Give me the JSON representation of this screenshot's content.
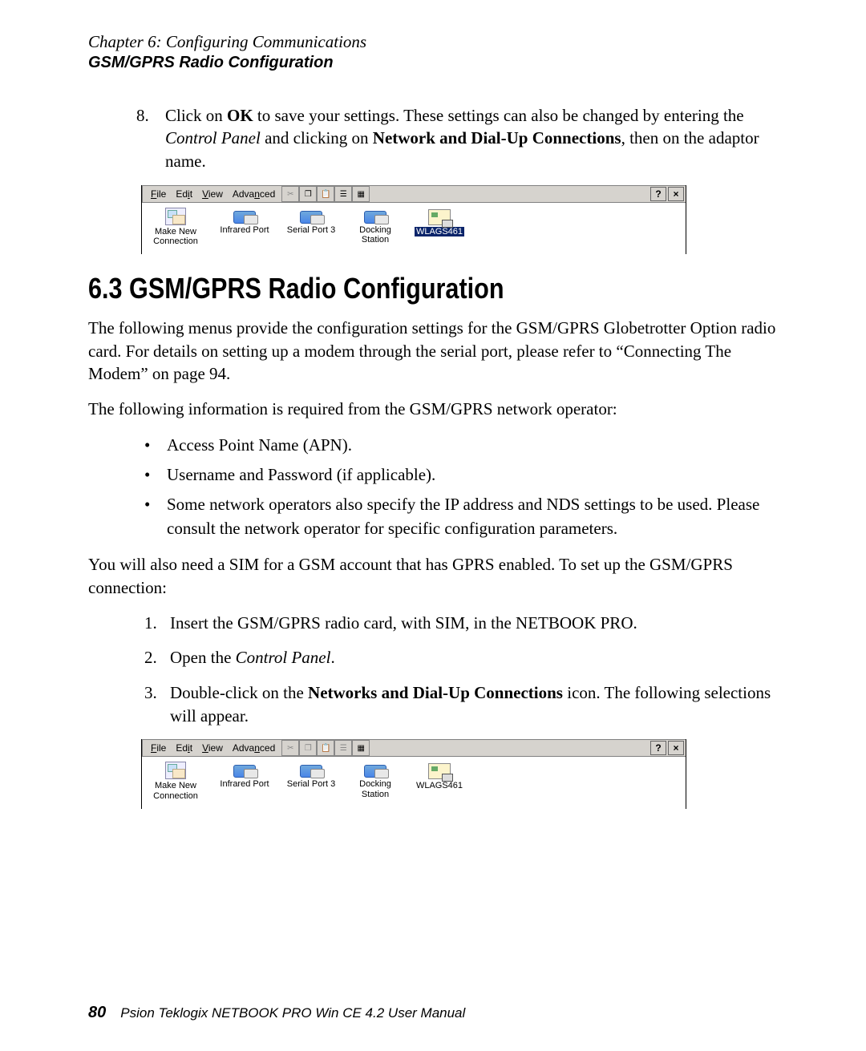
{
  "header": {
    "chapter": "Chapter 6:  Configuring Communications",
    "section": "GSM/GPRS Radio Configuration"
  },
  "step8": {
    "num": "8.",
    "pre": "Click on ",
    "ok": "OK",
    "mid1": " to save your settings. These settings can also be changed by entering the ",
    "cp": "Control Panel",
    "mid2": " and clicking on ",
    "ndc": "Network and Dial-Up Connections",
    "end": ", then on the adaptor name."
  },
  "window": {
    "menu": {
      "file_u": "F",
      "file_r": "ile",
      "edit_pre": "Ed",
      "edit_u": "i",
      "edit_post": "t",
      "view_u": "V",
      "view_r": "iew",
      "adv_pre": "Adva",
      "adv_u": "n",
      "adv_post": "ced"
    },
    "help": "?",
    "close": "×",
    "items": {
      "make_new_1": "Make New",
      "make_new_2": "Connection",
      "infrared": "Infrared Port",
      "serial": "Serial Port 3",
      "dock_1": "Docking",
      "dock_2": "Station",
      "wlags": "WLAGS461"
    }
  },
  "section63": {
    "title": "6.3  GSM/GPRS Radio Configuration",
    "p1": "The following menus provide the configuration settings for the GSM/GPRS Globetrotter Option radio card. For details on setting up a modem through the serial port, please refer to “Connecting The Modem” on page 94.",
    "p2": "The following information is required from the GSM/GPRS network operator:",
    "bullets": {
      "b1": "Access Point Name (APN).",
      "b2": "Username and Password (if applicable).",
      "b3": "Some network operators also specify the IP address and NDS settings to be used. Please consult the network operator for specific configuration parameters."
    },
    "p3": "You will also need a SIM for a GSM account that has GPRS enabled. To set up the GSM/GPRS connection:",
    "steps": {
      "s1_num": "1.",
      "s1_text": "Insert the GSM/GPRS radio card, with SIM, in the NETBOOK PRO.",
      "s2_num": "2.",
      "s2_pre": "Open the ",
      "s2_cp": "Control Panel",
      "s2_end": ".",
      "s3_num": "3.",
      "s3_pre": "Double-click on the ",
      "s3_bold": "Networks and Dial-Up Connections",
      "s3_end": " icon. The following selections will appear."
    }
  },
  "footer": {
    "page": "80",
    "text": "Psion Teklogix NETBOOK PRO Win CE 4.2 User Manual"
  }
}
